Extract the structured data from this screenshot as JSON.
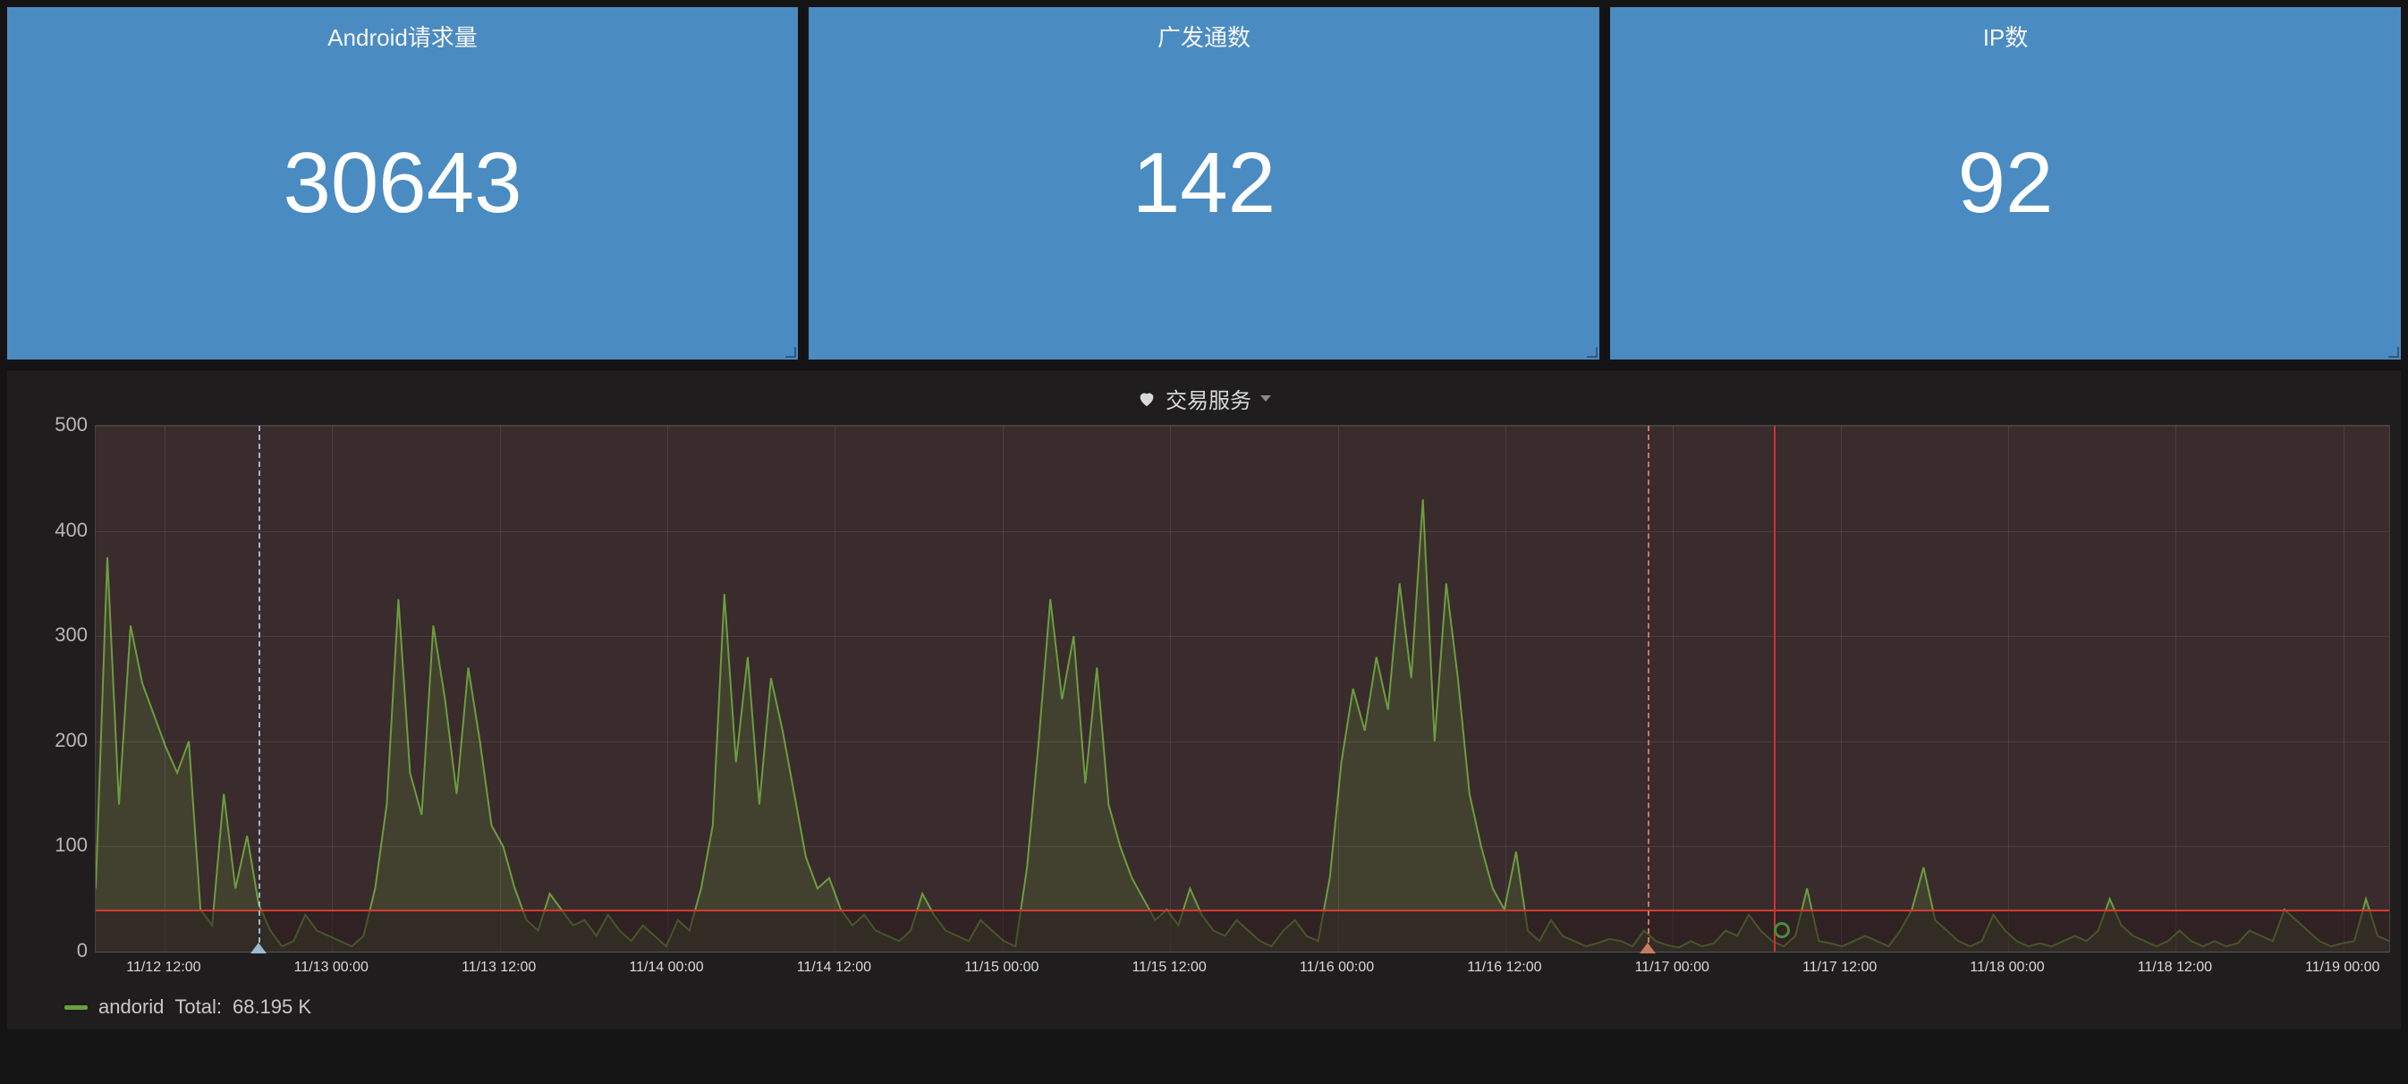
{
  "stats": [
    {
      "title": "Android请求量",
      "value": "30643"
    },
    {
      "title": "广发通数",
      "value": "142"
    },
    {
      "title": "IP数",
      "value": "92"
    }
  ],
  "graph": {
    "title": "交易服务",
    "legend_series": "andorid",
    "legend_stat_label": "Total:",
    "legend_stat_value": "68.195 K"
  },
  "chart_data": {
    "type": "line",
    "ylabel": "",
    "xlabel": "",
    "ylim": [
      0,
      500
    ],
    "yticks": [
      0,
      100,
      200,
      300,
      400,
      500
    ],
    "x_categories": [
      "11/12 12:00",
      "11/13 00:00",
      "11/13 12:00",
      "11/14 00:00",
      "11/14 12:00",
      "11/15 00:00",
      "11/15 12:00",
      "11/16 00:00",
      "11/16 12:00",
      "11/17 00:00",
      "11/17 12:00",
      "11/18 00:00",
      "11/18 12:00",
      "11/19 00:00"
    ],
    "threshold": 40,
    "annotations": [
      {
        "kind": "marker",
        "x_index": 0.56,
        "color": "#9bbad1"
      },
      {
        "kind": "marker",
        "x_index": 8.85,
        "color": "#c77b60"
      },
      {
        "kind": "event_line",
        "x_index": 9.6,
        "color": "#c33"
      },
      {
        "kind": "ok_point",
        "x_index": 9.65,
        "y": 20
      }
    ],
    "series": [
      {
        "name": "andorid",
        "color": "#6a9e3f",
        "values": [
          60,
          375,
          140,
          310,
          255,
          225,
          195,
          170,
          200,
          40,
          25,
          150,
          60,
          110,
          45,
          20,
          5,
          10,
          35,
          20,
          15,
          10,
          5,
          15,
          60,
          140,
          335,
          170,
          130,
          310,
          240,
          150,
          270,
          200,
          120,
          100,
          60,
          30,
          20,
          55,
          40,
          25,
          30,
          15,
          35,
          20,
          10,
          25,
          15,
          5,
          30,
          20,
          60,
          120,
          340,
          180,
          280,
          140,
          260,
          210,
          150,
          90,
          60,
          70,
          40,
          25,
          35,
          20,
          15,
          10,
          20,
          55,
          35,
          20,
          15,
          10,
          30,
          20,
          10,
          5,
          80,
          200,
          335,
          240,
          300,
          160,
          270,
          140,
          100,
          70,
          50,
          30,
          40,
          25,
          60,
          35,
          20,
          15,
          30,
          20,
          10,
          5,
          20,
          30,
          15,
          10,
          70,
          180,
          250,
          210,
          280,
          230,
          350,
          260,
          430,
          200,
          350,
          260,
          150,
          100,
          60,
          40,
          95,
          20,
          10,
          30,
          15,
          10,
          5,
          8,
          12,
          10,
          5,
          20,
          10,
          6,
          4,
          10,
          5,
          8,
          20,
          15,
          35,
          20,
          10,
          5,
          15,
          60,
          10,
          8,
          5,
          10,
          15,
          10,
          5,
          20,
          40,
          80,
          30,
          20,
          10,
          5,
          10,
          35,
          20,
          10,
          5,
          8,
          5,
          10,
          15,
          10,
          20,
          50,
          25,
          15,
          10,
          5,
          10,
          20,
          10,
          5,
          10,
          5,
          8,
          20,
          15,
          10,
          40,
          30,
          20,
          10,
          5,
          8,
          10,
          50,
          15,
          10
        ]
      }
    ]
  }
}
